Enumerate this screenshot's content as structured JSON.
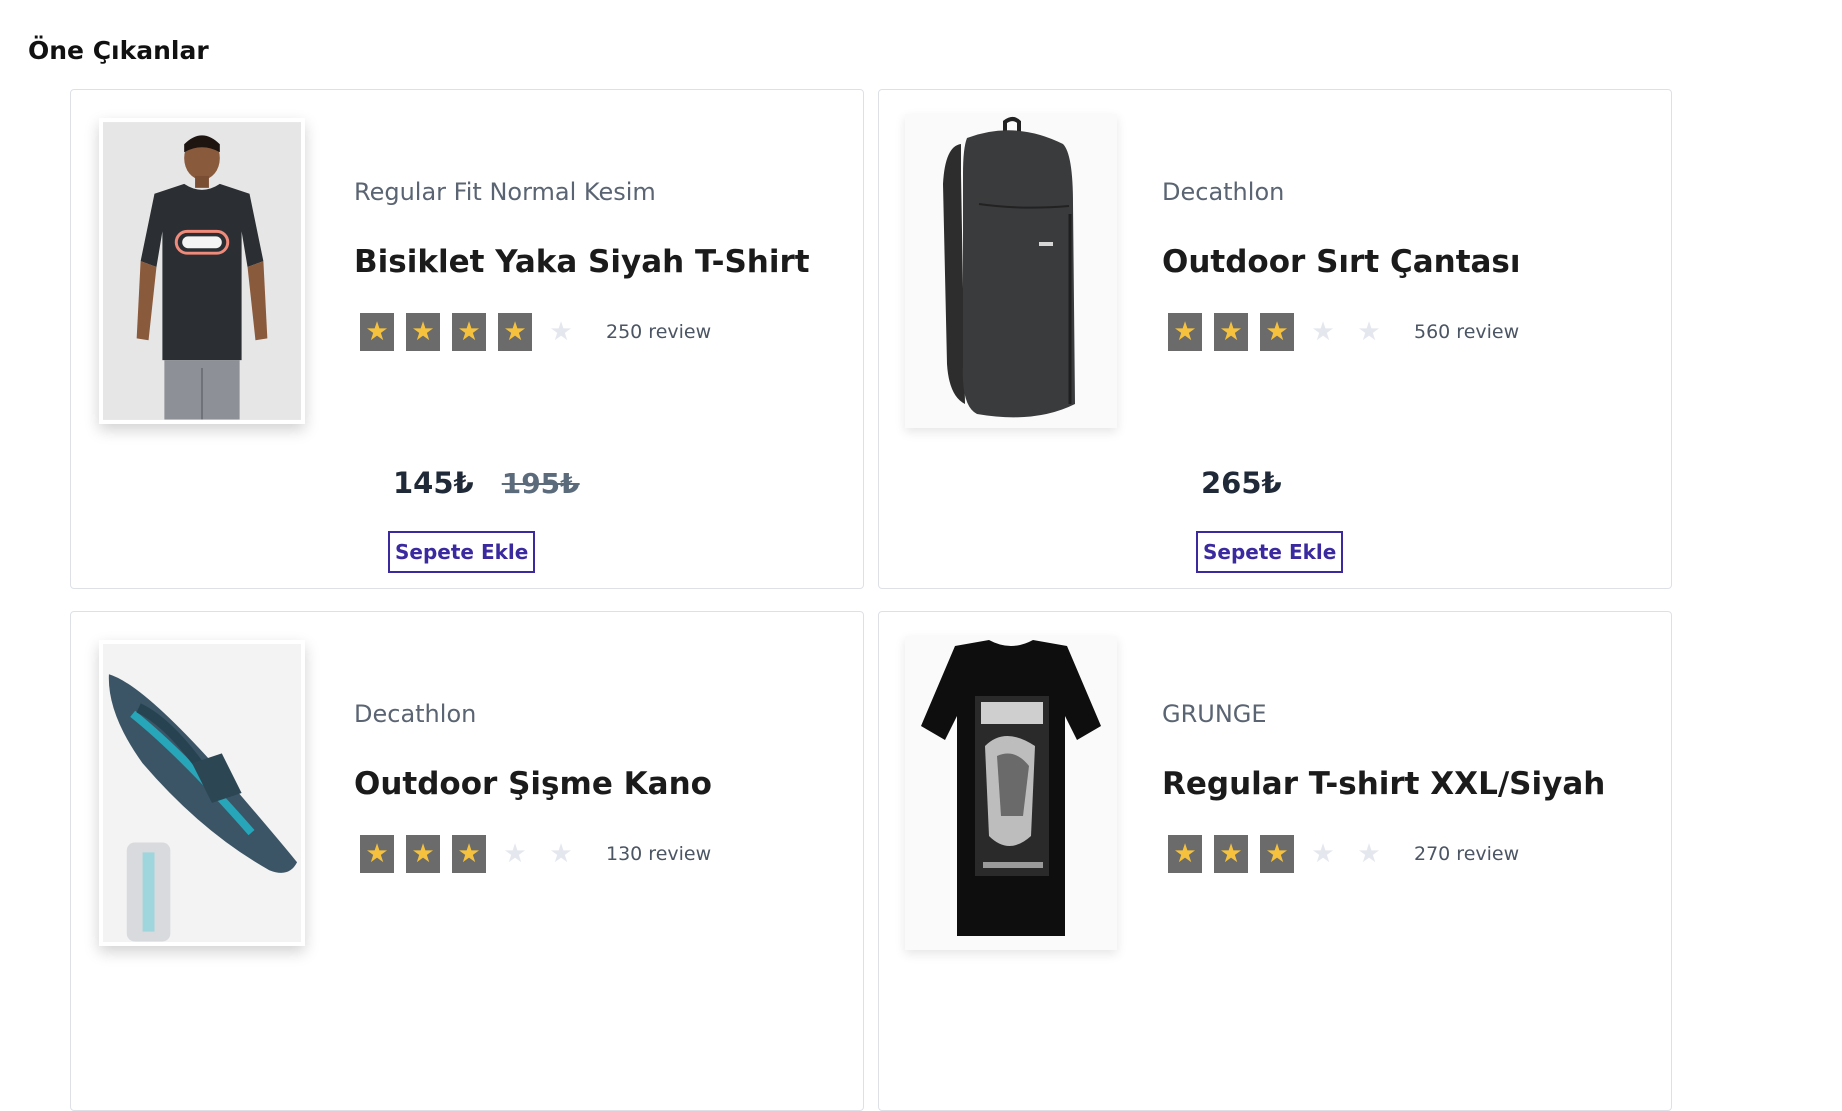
{
  "section": {
    "title": "Öne Çıkanlar"
  },
  "colors": {
    "accent": "#3b2a9f",
    "star_on": "#f6c23e",
    "star_bg": "#6b6b6b",
    "star_off": "#e5e7ef"
  },
  "products": [
    {
      "brand": "Regular Fit Normal Kesim",
      "name": "Bisiklet Yaka Siyah T-Shirt",
      "rating": 4,
      "reviews": "250 review",
      "price": "145₺",
      "old_price": "195₺",
      "button": "Sepete Ekle",
      "image": "tshirt-model"
    },
    {
      "brand": "Decathlon",
      "name": "Outdoor Sırt Çantası",
      "rating": 3,
      "reviews": "560 review",
      "price": "265₺",
      "old_price": "",
      "button": "Sepete Ekle",
      "image": "backpack"
    },
    {
      "brand": "Decathlon",
      "name": "Outdoor Şişme Kano",
      "rating": 3,
      "reviews": "130 review",
      "price": "",
      "old_price": "",
      "button": "",
      "image": "kayak"
    },
    {
      "brand": "GRUNGE",
      "name": "Regular T-shirt XXL/Siyah",
      "rating": 3,
      "reviews": "270 review",
      "price": "",
      "old_price": "",
      "button": "",
      "image": "graphic-tshirt"
    }
  ]
}
